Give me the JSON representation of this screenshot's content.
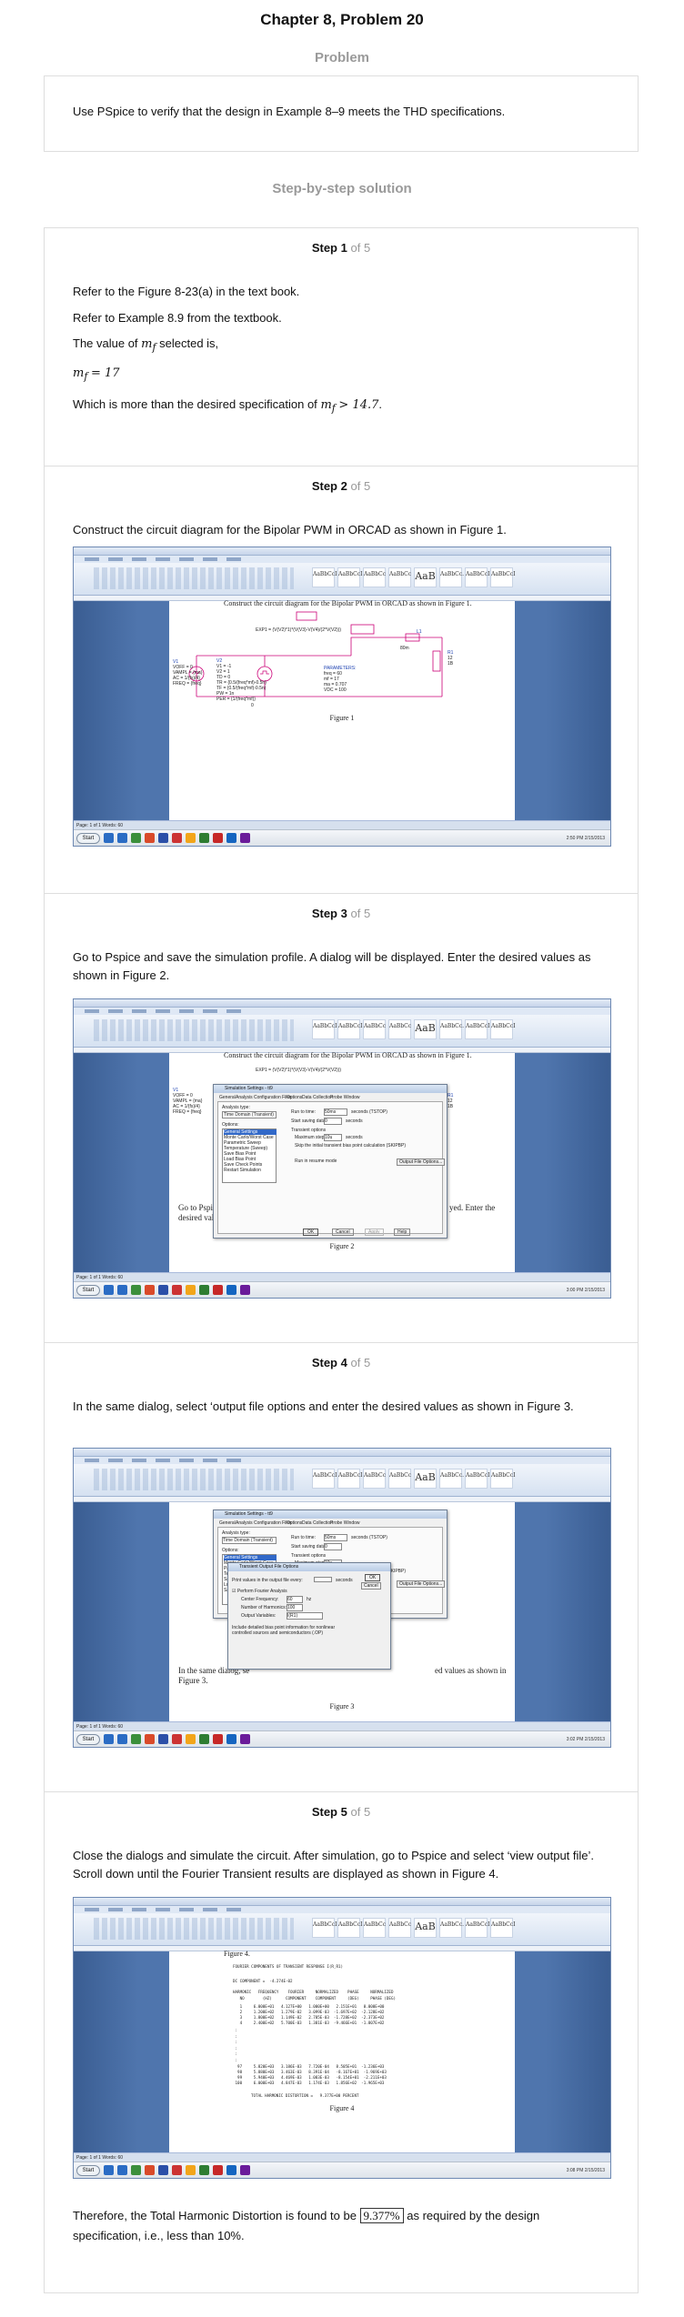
{
  "chapter_title": "Chapter 8, Problem 20",
  "problem_heading": "Problem",
  "problem_text": "Use PSpice to verify that the design in Example 8–9 meets the THD specifications.",
  "solution_heading": "Step-by-step solution",
  "step_word": "Step",
  "step_of": "of 5",
  "steps": [
    {
      "number": "1",
      "lines": [
        "Refer to the Figure 8-23(a) in the text book.",
        "Refer to Example 8.9 from the textbook."
      ],
      "value_prefix": "The value of",
      "value_var": "m",
      "value_sub": "f",
      "value_suffix": "selected is,",
      "equation_lhs": "m",
      "equation_sub": "f",
      "equation_rhs": "= 17",
      "conclusion_prefix": "Which is more than the desired specification of",
      "conclusion_var": "m",
      "conclusion_sub": "f",
      "conclusion_rhs": "> 14.7",
      "conclusion_end": "."
    },
    {
      "number": "2",
      "text": "Construct the circuit diagram for the Bipolar PWM in ORCAD as shown in Figure 1.",
      "figure_caption": "Figure 1",
      "doc_header": "Construct the circuit diagram for the Bipolar PWM in ORCAD as shown in Figure 1.",
      "expr": "EXP1 = (V(V2)*1)*(V(V3)-V(V4)/(2*V(V2)))",
      "source_v1": [
        "V1",
        "VOFF = 0",
        "VAMPL = {ma}",
        "AC = 1/{fs}/4}",
        "FREQ = {freq}"
      ],
      "source_v2": [
        "V2",
        "V1 = -1",
        "V2 = 1",
        "TD = 0",
        "TR = {0.5/(freq*mf)-0.5n}",
        "TF = {0.5/(freq*mf)-0.5n}",
        "PW = 1n",
        "PER = {1/(freq*mf)}"
      ],
      "parameters": [
        "PARAMETERS:",
        "freq = 60",
        "mf = 17",
        "ma = 0.707",
        "VDC = 100"
      ],
      "load": [
        "R1",
        "12",
        "1B"
      ],
      "inductor": "L1",
      "inductor_val": "80m",
      "ground": "0"
    },
    {
      "number": "3",
      "text": "Go to Pspice and save the simulation profile. A dialog will be displayed. Enter the desired values as shown in Figure 2.",
      "figure_caption": "Figure 2",
      "dialog_title": "Simulation Settings - tt9",
      "dialog_tabs": [
        "General",
        "Analysis",
        "Configuration Files",
        "Options",
        "Data Collection",
        "Probe Window"
      ],
      "analysis_type_label": "Analysis type:",
      "analysis_type_value": "Time Domain (Transient)",
      "options_label": "Options:",
      "options_list": [
        "General Settings",
        "Monte Carlo/Worst Case",
        "Parametric Sweep",
        "Temperature (Sweep)",
        "Save Bias Point",
        "Load Bias Point",
        "Save Check Points",
        "Restart Simulation"
      ],
      "run_to_time_label": "Run to time:",
      "run_to_time_value": "50ms",
      "run_to_time_unit": "seconds (TSTOP)",
      "start_saving_label": "Start saving data after:",
      "start_saving_value": "0",
      "start_saving_unit": "seconds",
      "transient_options_label": "Transient options",
      "max_step_label": "Maximum step size:",
      "max_step_value": "10u",
      "max_step_unit": "seconds",
      "skip_bias_label": "Skip the initial transient bias point calculation (SKIPBP)",
      "resume_label": "Run in resume mode",
      "output_file_options_button": "Output File Options...",
      "ok_button": "OK",
      "cancel_button": "Cancel",
      "apply_button": "Apply",
      "help_button": "Help",
      "doc_text_left": "Go to Pspice a",
      "doc_text_left2": "desired values a",
      "doc_text_right": "yed. Enter the"
    },
    {
      "number": "4",
      "text": "In the same dialog, select ‘output file options and enter the desired values as shown in Figure 3.",
      "figure_caption": "Figure 3",
      "subdialog_title": "Transient Output File Options",
      "print_values_label": "Print values in the output file every:",
      "print_values_unit": "seconds",
      "fourier_label": "Perform Fourier Analysis",
      "center_freq_label": "Center Frequency:",
      "center_freq_value": "60",
      "center_freq_unit": "hz",
      "harmonics_label": "Number of Harmonics:",
      "harmonics_value": "100",
      "output_vars_label": "Output Variables:",
      "output_vars_value": "I(R1)",
      "detailed_label": "Include detailed bias point information for nonlinear controlled sources and semiconductors (.OP)",
      "doc_text_left": "In the same dialog, se",
      "doc_text_left2": "Figure 3.",
      "doc_text_right": "ed values as shown in"
    },
    {
      "number": "5",
      "text": "Close the dialogs and simulate the circuit. After simulation, go to Pspice and select ‘view output file’. Scroll down until the Fourier Transient results are displayed as shown in Figure 4.",
      "figure_caption": "Figure 4",
      "doc_header": "Figure 4.",
      "fourier_title": "FOURIER COMPONENTS OF TRANSIENT RESPONSE I(R_R1)",
      "dc_component": "DC COMPONENT =  -4.274E-02",
      "table_header": "HARMONIC   FREQUENCY    FOURIER     NORMALIZED    PHASE     NORMALIZED\n   NO        (HZ)      COMPONENT    COMPONENT     (DEG)     PHASE (DEG)",
      "rows_top": [
        "   1     6.000E+01   4.127E+00   1.000E+00   2.151E+01   0.000E+00",
        "   2     1.200E+02   1.279E-02   3.099E-03  -1.697E+02  -2.128E+02",
        "   3     1.800E+02   1.149E-02   2.785E-03  -1.728E+02  -2.373E+02",
        "   4     2.400E+02   5.700E-03   1.381E-03  -9.466E+01  -1.807E+02"
      ],
      "rows_bottom": [
        "  97     5.820E+03   3.186E-03   7.720E-04   8.505E+01  -1.236E+03",
        "  98     5.880E+03   3.463E-03   8.391E-04   -8.167E+01  -1.969E+03",
        "  99     5.940E+03   4.469E-03   1.083E-03   -8.154E+01  -2.211E+03",
        " 100     6.000E+03   4.847E-03   1.174E-03   1.856E+02  -1.965E+03"
      ],
      "thd_line": "TOTAL HARMONIC DISTORTION =   9.377E+00 PERCENT",
      "final_prefix": "Therefore, the Total Harmonic Distortion is found to be",
      "final_value": "9.377%",
      "final_suffix": "as required by the design specification, i.e., less than 10%."
    }
  ],
  "word": {
    "window_title": "tt9 - Microsoft Word",
    "tabs": [
      "Home",
      "Insert",
      "Page Layout",
      "References",
      "Mailings",
      "Review",
      "View"
    ],
    "style_samples": [
      "AaBbCcI",
      "AaBbCcI",
      "AaBbCc",
      "AaBbCc",
      "AaB",
      "AaBbCc.",
      "AaBbCcI",
      "AaBbCcI"
    ],
    "status_left": "Page: 1 of 1   Words: 60",
    "start_label": "Start",
    "clock_1": "2:50 PM\n2/15/2013",
    "clock_2": "3:00 PM\n2/15/2013",
    "clock_3": "3:02 PM\n2/15/2013",
    "clock_4": "3:08 PM\n2/15/2013"
  },
  "colors": {
    "muted_heading": "#9a9a9a",
    "card_border": "#dedede",
    "schematic_wire": "#cc0077",
    "schematic_label": "#1a3fb0"
  }
}
